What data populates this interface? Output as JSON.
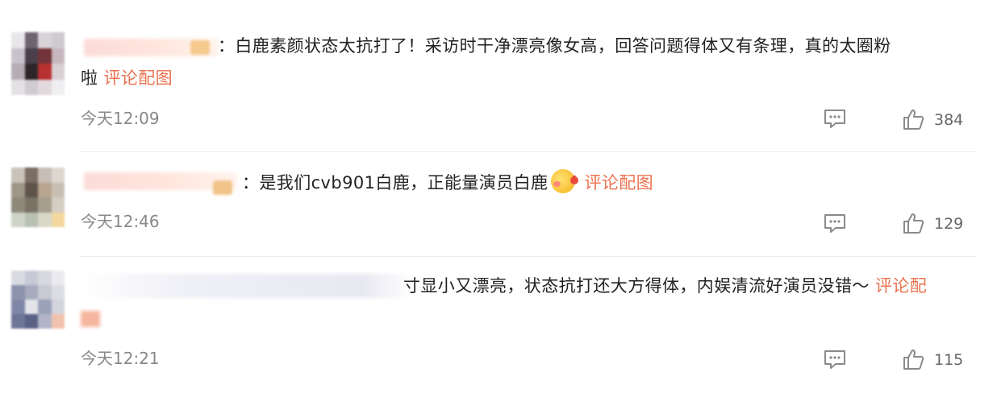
{
  "comments": [
    {
      "text": "白鹿素颜状态太抗打了！采访时干净漂亮像女高，回答问题得体又有条理，真的太圈粉",
      "text2": "啦",
      "link": "评论配图",
      "time": "今天12:09",
      "likes": "384"
    },
    {
      "text": "是我们cvb901白鹿，正能量演员白鹿",
      "link": "评论配图",
      "time": "今天12:46",
      "likes": "129"
    },
    {
      "text": "寸显小又漂亮，状态抗打还大方得体，内娱清流好演员没错～",
      "link": "评论配",
      "time": "今天12:21",
      "likes": "115"
    }
  ]
}
